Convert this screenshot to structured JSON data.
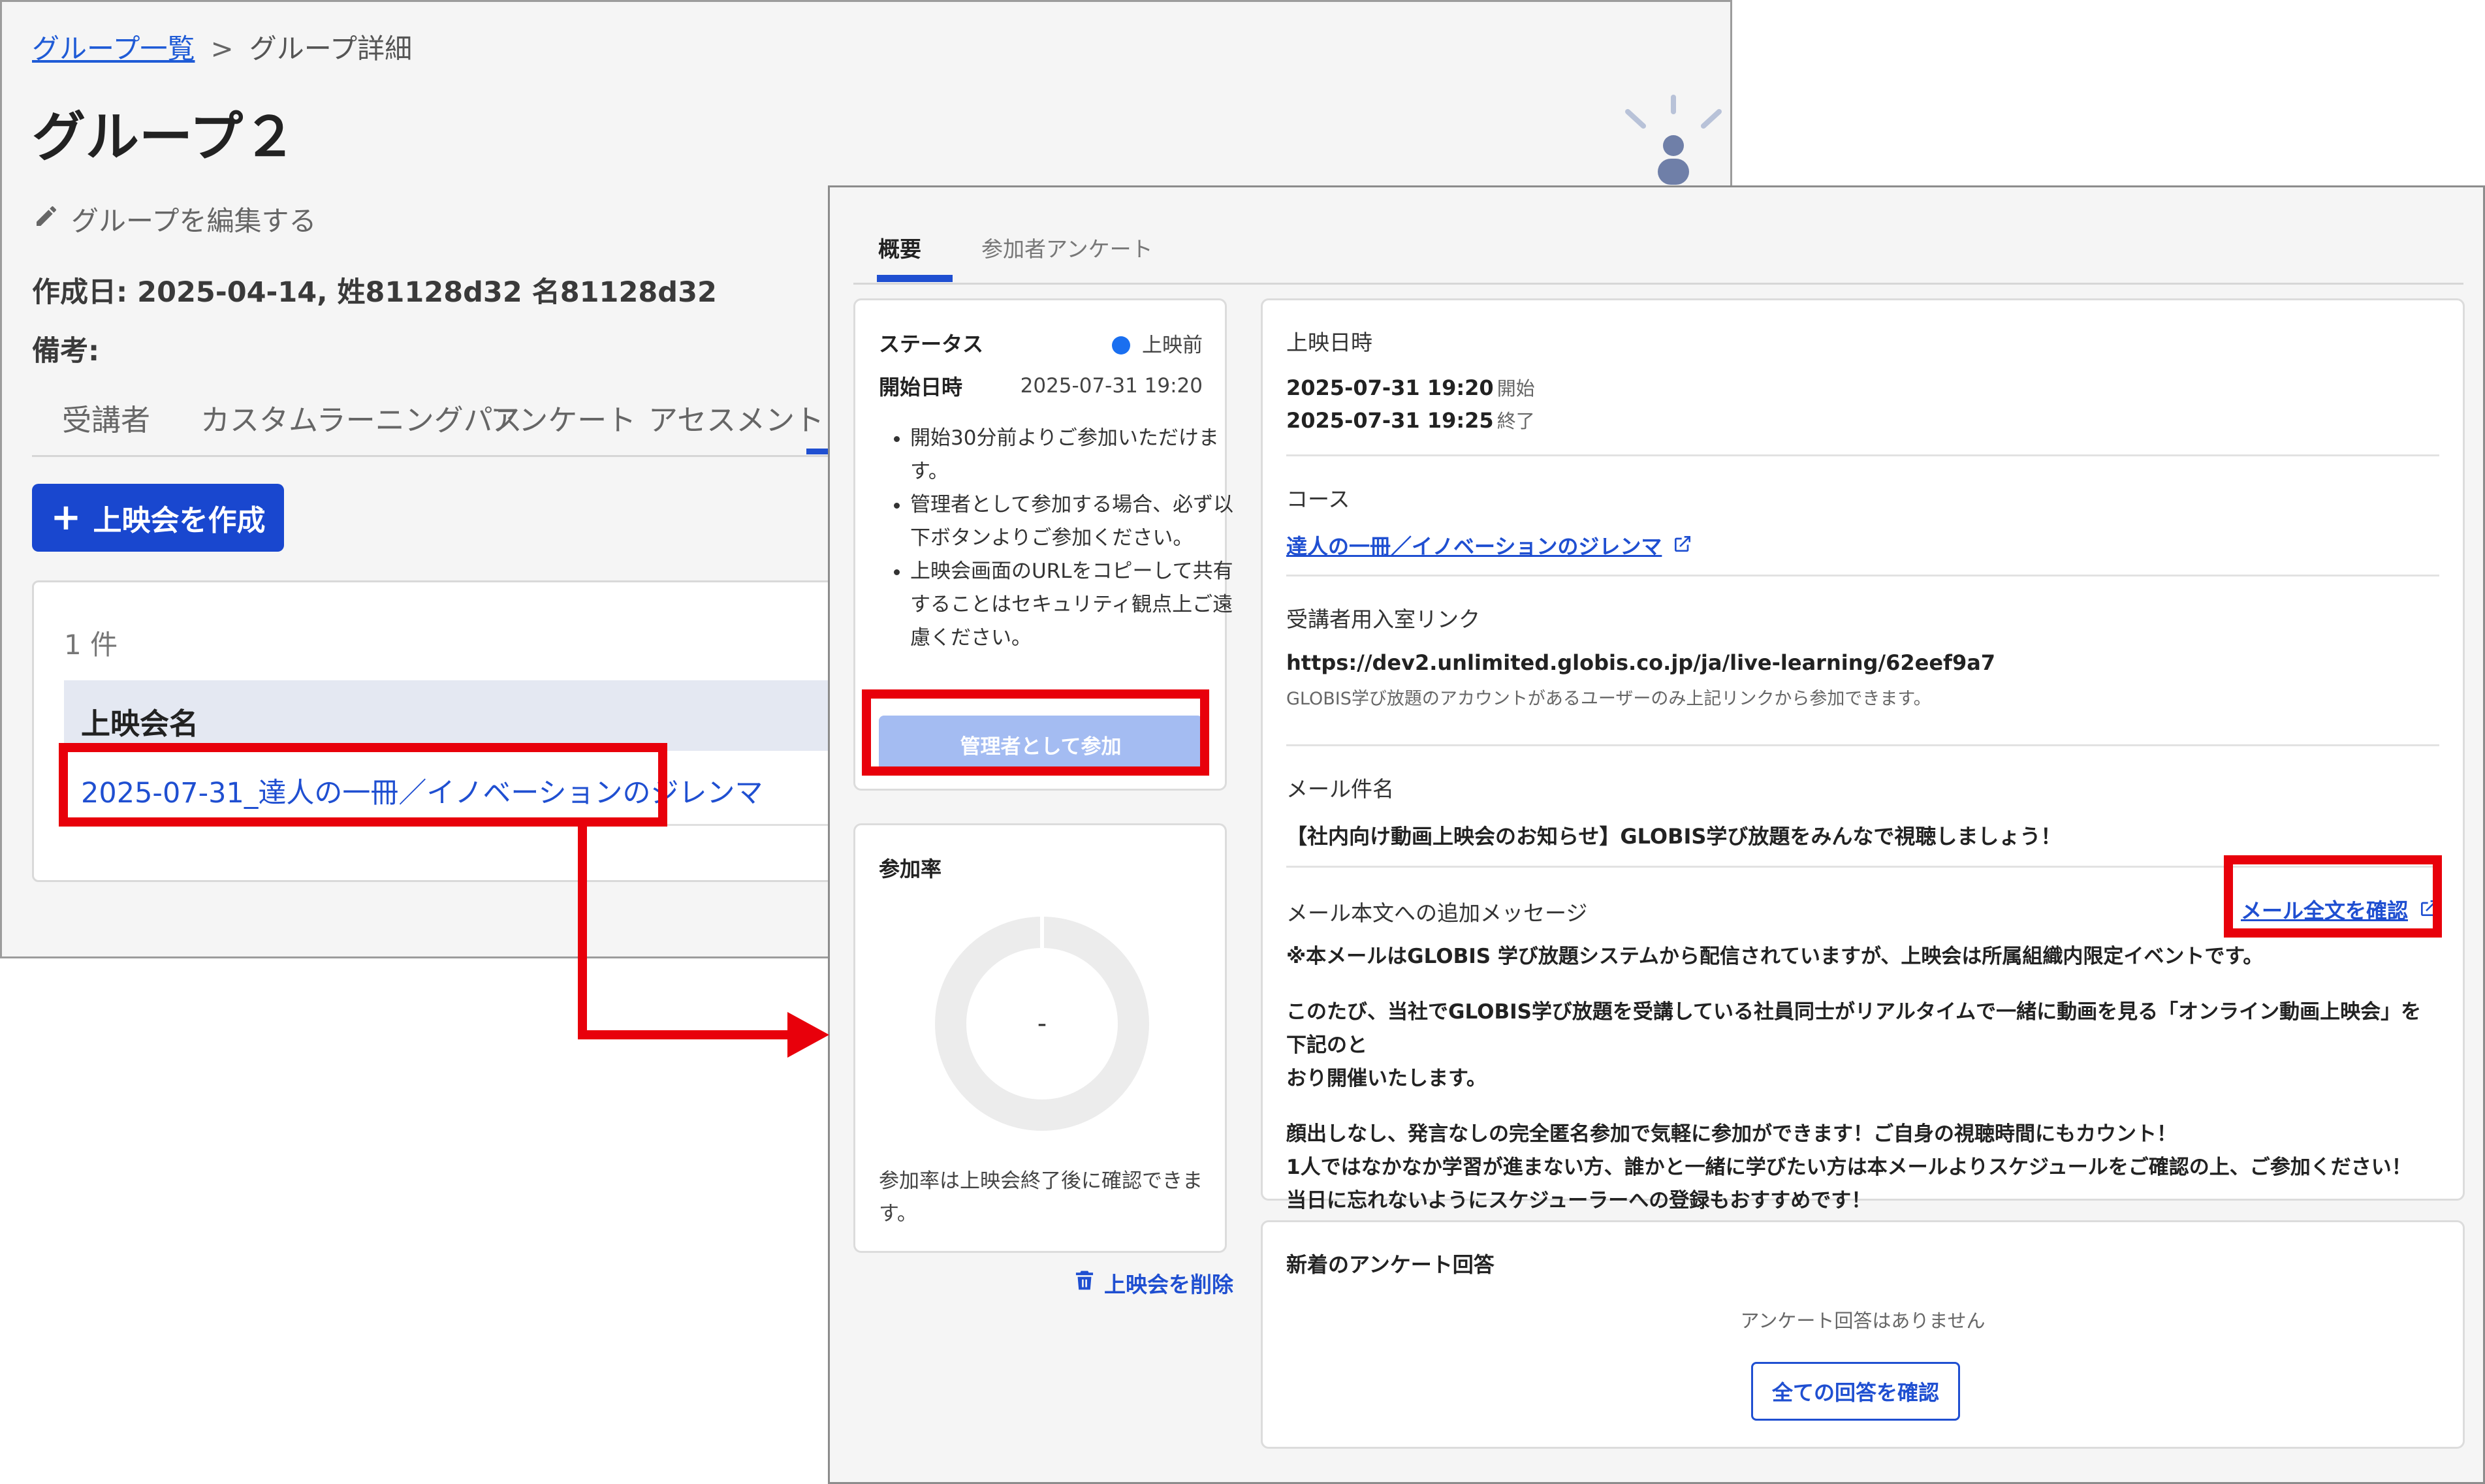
{
  "bg": {
    "breadcrumb": {
      "link": "グループ一覧",
      "separator": ">",
      "current": "グループ詳細"
    },
    "title": "グループ２",
    "edit_label": "グループを編集する",
    "meta": "作成日: 2025-04-14, 姓81128d32 名81128d32",
    "remarks_label": "備考:",
    "tabs": [
      "受講者",
      "カスタムラーニングパス",
      "アンケート",
      "アセスメント"
    ],
    "create_button": "上映会を作成",
    "results_count": "1 件",
    "table_header": "上映会名",
    "screening_name": "2025-07-31_達人の一冊／イノベーションのジレンマ"
  },
  "fg": {
    "tabs": [
      "概要",
      "参加者アンケート"
    ],
    "status": {
      "label": "ステータス",
      "value": "上映前",
      "start_label": "開始日時",
      "start_value": "2025-07-31 19:20",
      "notes": [
        "開始30分前よりご参加いただけます。",
        "管理者として参加する場合、必ず以下ボタンよりご参加ください。",
        "上映会画面のURLをコピーして共有することはセキュリティ観点上ご遠慮ください。"
      ],
      "admin_button": "管理者として参加"
    },
    "rate": {
      "title": "参加率",
      "value": "-",
      "note": "参加率は上映会終了後に確認できます。"
    },
    "delete_label": "上映会を削除",
    "info": {
      "datetime_label": "上映日時",
      "start_time": "2025-07-31 19:20",
      "start_suffix": "開始",
      "end_time": "2025-07-31 19:25",
      "end_suffix": "終了",
      "course_label": "コース",
      "course_link": "達人の一冊／イノベーションのジレンマ",
      "room_label": "受講者用入室リンク",
      "room_url": "https://dev2.unlimited.globis.co.jp/ja/live-learning/62eef9a7",
      "room_note": "GLOBIS学び放題のアカウントがあるユーザーのみ上記リンクから参加できます。",
      "mail_subject_label": "メール件名",
      "mail_subject": "【社内向け動画上映会のお知らせ】GLOBIS学び放題をみんなで視聴しましょう！",
      "mail_body_label": "メール本文への追加メッセージ",
      "mail_full_link": "メール全文を確認",
      "mail_lines": [
        "※本メールはGLOBIS 学び放題システムから配信されていますが、上映会は所属組織内限定イベントです。",
        "このたび、当社でGLOBIS学び放題を受講している社員同士がリアルタイムで一緒に動画を見る「オンライン動画上映会」を下記のと",
        "おり開催いたします。",
        "顔出しなし、発言なしの完全匿名参加で気軽に参加ができます！ご自身の視聴時間にもカウント！",
        "1人ではなかなか学習が進まない方、誰かと一緒に学びたい方は本メールよりスケジュールをご確認の上、ご参加ください！",
        "当日に忘れないようにスケジューラーへの登録もおすすめです！"
      ]
    },
    "survey": {
      "title": "新着のアンケート回答",
      "empty": "アンケート回答はありません",
      "button": "全ての回答を確認"
    }
  },
  "colors": {
    "accent": "#1f4fd1",
    "annotation_red": "#e8000b",
    "status_dot": "#1a6ff0",
    "admin_button_disabled": "#a4bcf2"
  }
}
